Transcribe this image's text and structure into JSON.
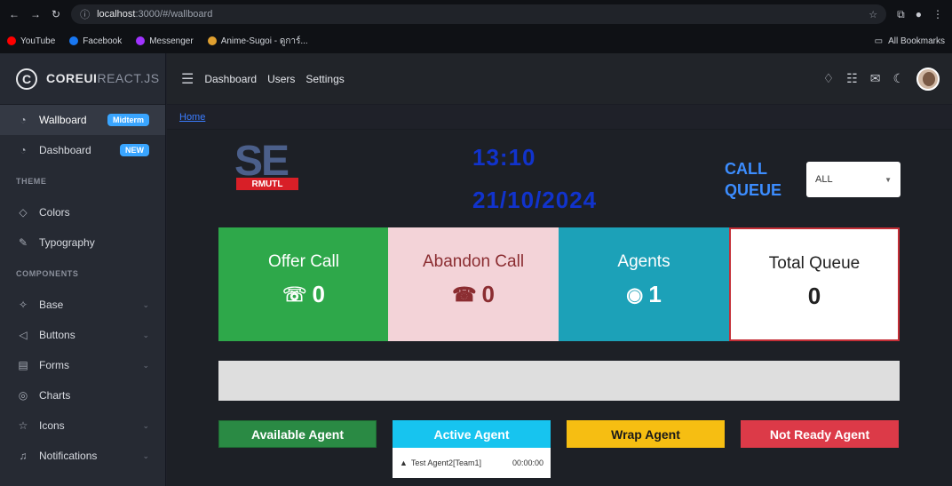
{
  "browser": {
    "url_host": "localhost",
    "url_path": ":3000/#/wallboard",
    "bookmarks": [
      "YouTube",
      "Facebook",
      "Messenger",
      "Anime-Sugoi - ดูการ์..."
    ],
    "all_bookmarks": "All Bookmarks"
  },
  "brand": {
    "main": "COREUI",
    "sub": "REACT.JS"
  },
  "sidebar": {
    "items": [
      {
        "label": "Wallboard",
        "badge": "Midterm"
      },
      {
        "label": "Dashboard",
        "badge": "NEW"
      }
    ],
    "theme_title": "THEME",
    "theme_items": [
      "Colors",
      "Typography"
    ],
    "components_title": "COMPONENTS",
    "component_items": [
      "Base",
      "Buttons",
      "Forms",
      "Charts",
      "Icons",
      "Notifications"
    ]
  },
  "header": {
    "links": [
      "Dashboard",
      "Users",
      "Settings"
    ]
  },
  "breadcrumb": {
    "home": "Home"
  },
  "wallboard": {
    "logo_text": "SE",
    "logo_sub": "RMUTL",
    "time": "13:10",
    "date": "21/10/2024",
    "queue_title": "CALL QUEUE",
    "queue_select": "ALL",
    "stats": [
      {
        "label": "Offer Call",
        "value": "0"
      },
      {
        "label": "Abandon Call",
        "value": "0"
      },
      {
        "label": "Agents",
        "value": "1"
      },
      {
        "label": "Total Queue",
        "value": "0"
      }
    ],
    "agent_buttons": [
      "Available Agent",
      "Active Agent",
      "Wrap Agent",
      "Not Ready Agent"
    ],
    "active_agents": [
      {
        "name": "Test Agent2[Team1]",
        "time": "00:00:00"
      }
    ]
  },
  "colors": {
    "offer": "#2ea84a",
    "abandon": "#f3d3d8",
    "agents": "#1ca1b8",
    "total_border": "#c42f37",
    "clock": "#1133cc",
    "queue_title": "#3c8dff"
  }
}
